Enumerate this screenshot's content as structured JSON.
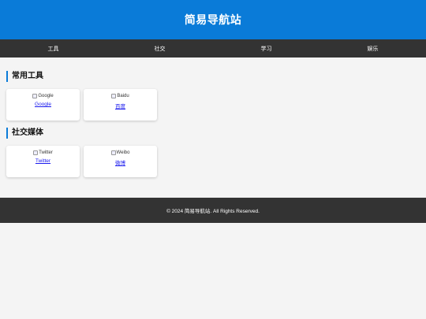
{
  "header": {
    "title": "简易导航站"
  },
  "nav": {
    "items": [
      "工具",
      "社交",
      "学习",
      "娱乐"
    ]
  },
  "sections": [
    {
      "title": "常用工具",
      "cards": [
        {
          "img_alt": "Google",
          "link": "Google"
        },
        {
          "img_alt": "Baidu",
          "link": "百度"
        }
      ]
    },
    {
      "title": "社交媒体",
      "cards": [
        {
          "img_alt": "Twitter",
          "link": "Twitter"
        },
        {
          "img_alt": "Weibo",
          "link": "微博"
        }
      ]
    }
  ],
  "footer": {
    "text": "© 2024 简易导航站. All Rights Reserved."
  },
  "colors": {
    "header_bg": "#0a7bd8",
    "nav_bg": "#333333",
    "accent": "#0a7bd8"
  }
}
